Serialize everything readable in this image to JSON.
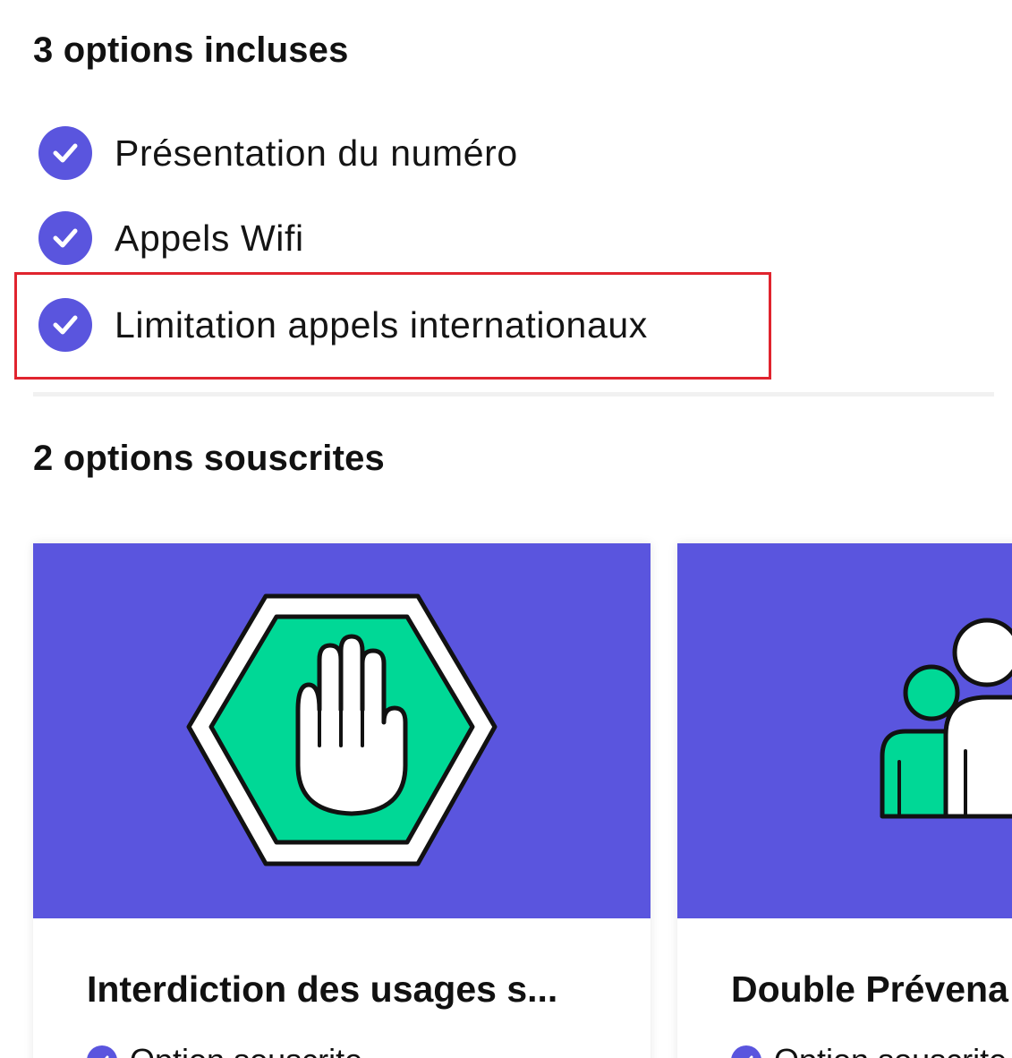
{
  "colors": {
    "accent": "#5a55de",
    "highlight_border": "#e0242e",
    "stop_green": "#00d896"
  },
  "included": {
    "title": "3 options incluses",
    "items": [
      {
        "label": "Présentation du numéro",
        "icon": "check-circle-icon"
      },
      {
        "label": "Appels Wifi",
        "icon": "check-circle-icon"
      },
      {
        "label": "Limitation appels internationaux",
        "icon": "check-circle-icon"
      }
    ]
  },
  "subscribed": {
    "title": "2 options souscrites",
    "cards": [
      {
        "title": "Interdiction des usages s...",
        "status": "Option souscrite",
        "icon": "stop-hand-icon"
      },
      {
        "title": "Double Prévena",
        "status": "Option souscrite",
        "icon": "family-icon"
      }
    ]
  }
}
